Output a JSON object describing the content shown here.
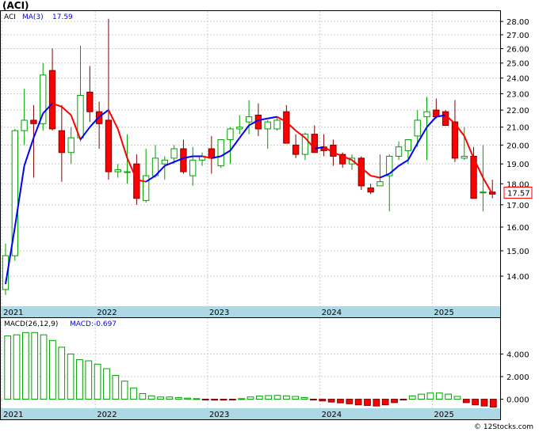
{
  "header": {
    "symbol": "(ACI)"
  },
  "watermark": "© 12Stocks.com",
  "colors": {
    "up_candle": "#00a000",
    "down_candle": "#ff0000",
    "ma_up": "#0000ff",
    "ma_down": "#ff0000",
    "macd_pos": "#00a000",
    "macd_neg": "#ff0000",
    "axis_band": "#add8e6",
    "grid": "#cccccc",
    "last_price_box": "#ff0000"
  },
  "chart_data": [
    {
      "type": "candlestick",
      "title": "ACI",
      "interval": "monthly",
      "legend": {
        "symbol": "ACI",
        "ma_label": "MA(3)",
        "ma_value": "17.59"
      },
      "last_price": "17.57",
      "ylim": [
        12.9,
        28.8
      ],
      "y_scale": "log",
      "y_ticks": [
        "28.00",
        "27.00",
        "26.00",
        "25.00",
        "24.00",
        "23.00",
        "22.00",
        "21.00",
        "20.00",
        "19.00",
        "18.00",
        "17.00",
        "16.00",
        "15.00",
        "14.00"
      ],
      "x_labels": [
        "2021",
        "2022",
        "2023",
        "2024",
        "2025"
      ],
      "x_label_months": [
        0,
        10,
        22,
        34,
        46
      ],
      "grid": true,
      "candles": [
        [
          13.5,
          15.3,
          13.3,
          14.8
        ],
        [
          14.8,
          20.9,
          14.6,
          20.8
        ],
        [
          20.8,
          23.3,
          20.0,
          21.4
        ],
        [
          21.4,
          22.3,
          18.3,
          21.2
        ],
        [
          21.2,
          25.0,
          20.8,
          24.2
        ],
        [
          24.5,
          26.0,
          20.8,
          20.9
        ],
        [
          20.8,
          22.3,
          18.1,
          19.6
        ],
        [
          19.6,
          21.0,
          19.0,
          20.4
        ],
        [
          20.4,
          26.2,
          20.2,
          22.9
        ],
        [
          23.1,
          24.8,
          21.3,
          21.9
        ],
        [
          21.9,
          22.5,
          19.8,
          21.2
        ],
        [
          21.4,
          28.2,
          18.2,
          18.6
        ],
        [
          18.6,
          19.0,
          18.3,
          18.7
        ],
        [
          18.6,
          20.6,
          18.0,
          18.6
        ],
        [
          19.0,
          19.5,
          17.0,
          17.3
        ],
        [
          17.2,
          19.8,
          17.1,
          18.4
        ],
        [
          18.4,
          20.0,
          18.3,
          19.3
        ],
        [
          19.0,
          19.4,
          18.2,
          19.2
        ],
        [
          19.3,
          20.0,
          19.0,
          19.8
        ],
        [
          19.8,
          20.3,
          18.5,
          18.6
        ],
        [
          18.4,
          19.9,
          17.9,
          19.2
        ],
        [
          19.2,
          19.6,
          18.9,
          19.4
        ],
        [
          19.8,
          20.5,
          18.5,
          19.3
        ],
        [
          18.9,
          19.6,
          18.8,
          20.3
        ],
        [
          20.3,
          21.0,
          19.0,
          20.9
        ],
        [
          20.9,
          21.7,
          20.6,
          21.0
        ],
        [
          21.3,
          22.6,
          20.6,
          21.6
        ],
        [
          21.7,
          22.4,
          20.5,
          20.9
        ],
        [
          20.9,
          21.4,
          19.8,
          21.3
        ],
        [
          20.9,
          21.6,
          20.8,
          21.4
        ],
        [
          21.9,
          22.3,
          20.3,
          20.1
        ],
        [
          20.0,
          20.6,
          19.3,
          19.5
        ],
        [
          19.5,
          20.7,
          19.2,
          20.6
        ],
        [
          20.6,
          21.1,
          20.0,
          19.6
        ],
        [
          19.9,
          20.6,
          19.4,
          19.7
        ],
        [
          20.0,
          20.3,
          18.9,
          19.4
        ],
        [
          19.5,
          19.6,
          18.8,
          19.0
        ],
        [
          19.0,
          19.5,
          18.7,
          19.3
        ],
        [
          19.3,
          19.4,
          17.7,
          17.9
        ],
        [
          17.8,
          18.0,
          17.5,
          17.6
        ],
        [
          17.9,
          19.5,
          17.9,
          18.1
        ],
        [
          18.4,
          19.5,
          16.7,
          19.4
        ],
        [
          19.4,
          20.2,
          19.2,
          19.9
        ],
        [
          19.7,
          20.1,
          19.0,
          20.3
        ],
        [
          20.5,
          22.0,
          19.9,
          21.4
        ],
        [
          21.6,
          22.8,
          19.2,
          21.9
        ],
        [
          22.0,
          22.7,
          21.5,
          21.6
        ],
        [
          21.9,
          22.0,
          21.2,
          21.1
        ],
        [
          21.3,
          22.6,
          19.1,
          19.3
        ],
        [
          19.3,
          21.0,
          19.2,
          19.4
        ],
        [
          19.4,
          19.9,
          17.6,
          17.3
        ],
        [
          17.6,
          20.0,
          16.7,
          17.6
        ],
        [
          17.6,
          18.2,
          17.3,
          17.5
        ]
      ],
      "ma3": [
        13.7,
        16.0,
        18.9,
        20.4,
        21.8,
        22.4,
        22.2,
        21.7,
        20.3,
        21.0,
        21.6,
        22.0,
        20.9,
        19.3,
        18.2,
        18.1,
        18.4,
        18.9,
        19.1,
        19.3,
        19.4,
        19.4,
        19.3,
        19.4,
        19.7,
        20.4,
        21.1,
        21.4,
        21.5,
        21.6,
        21.3,
        20.8,
        20.4,
        19.8,
        19.9,
        19.6,
        19.4,
        19.2,
        18.8,
        18.4,
        18.3,
        18.5,
        18.9,
        19.2,
        20.1,
        21.0,
        21.6,
        21.7,
        21.2,
        20.5,
        19.3,
        18.3,
        17.5
      ],
      "macd_legend": {
        "label": "MACD(26,12,9)",
        "value": "MACD:-0.697"
      },
      "macd_ylim": [
        -0.8,
        6.2
      ],
      "macd_ticks": [
        "4.000",
        "2.000",
        "0.000"
      ],
      "macd_hist": [
        5.6,
        5.7,
        5.9,
        5.9,
        5.7,
        5.2,
        4.6,
        4.0,
        3.5,
        3.4,
        3.1,
        2.7,
        2.1,
        1.6,
        1.0,
        0.5,
        0.3,
        0.2,
        0.2,
        0.15,
        0.1,
        0.05,
        -0.05,
        -0.08,
        -0.08,
        -0.05,
        0.05,
        0.2,
        0.28,
        0.32,
        0.34,
        0.3,
        0.25,
        0.15,
        -0.05,
        -0.15,
        -0.25,
        -0.32,
        -0.4,
        -0.5,
        -0.55,
        -0.6,
        -0.5,
        -0.3,
        -0.05,
        0.3,
        0.45,
        0.55,
        0.55,
        0.45,
        0.25,
        -0.3,
        -0.5,
        -0.6,
        -0.697
      ]
    }
  ]
}
